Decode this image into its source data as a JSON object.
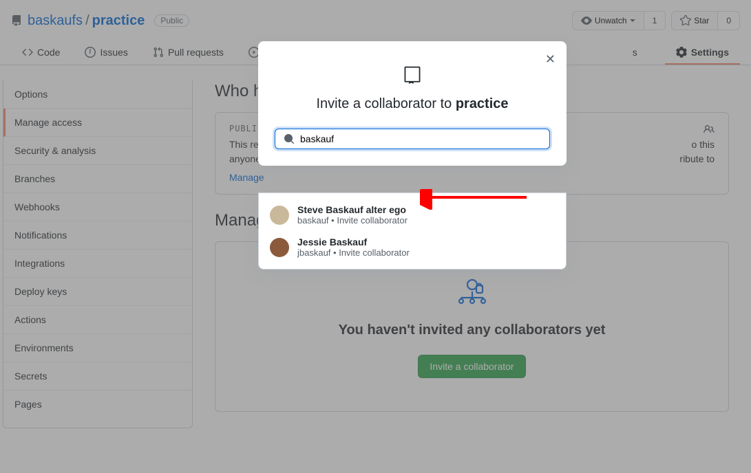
{
  "breadcrumb": {
    "owner": "baskaufs",
    "repo": "practice",
    "badge": "Public"
  },
  "header": {
    "unwatch": "Unwatch",
    "unwatch_count": "1",
    "star": "Star",
    "star_count": "0"
  },
  "tabs": {
    "code": "Code",
    "issues": "Issues",
    "pulls": "Pull requests",
    "actions_letter": "A",
    "partial_s": "s",
    "settings": "Settings"
  },
  "sidebar": {
    "items": [
      "Options",
      "Manage access",
      "Security & analysis",
      "Branches",
      "Webhooks",
      "Notifications",
      "Integrations",
      "Deploy keys",
      "Actions",
      "Environments",
      "Secrets",
      "Pages"
    ]
  },
  "main": {
    "who_title": "Who h",
    "access_label": "PUBLIC",
    "access_desc_1": "This re",
    "access_desc_2": "o this",
    "access_desc_3": "anyone.",
    "access_desc_4": "ribute to",
    "manage_link": "Manage",
    "manage_title": "Manage access",
    "empty": "You haven't invited any collaborators yet",
    "invite_btn": "Invite a collaborator"
  },
  "modal": {
    "title_prefix": "Invite a collaborator to ",
    "title_repo": "practice",
    "search": "baskauf"
  },
  "suggestions": [
    {
      "name": "Steve Baskauf alter ego",
      "username": "baskauf",
      "action": "Invite collaborator"
    },
    {
      "name": "Jessie Baskauf",
      "username": "jbaskauf",
      "action": "Invite collaborator"
    }
  ]
}
